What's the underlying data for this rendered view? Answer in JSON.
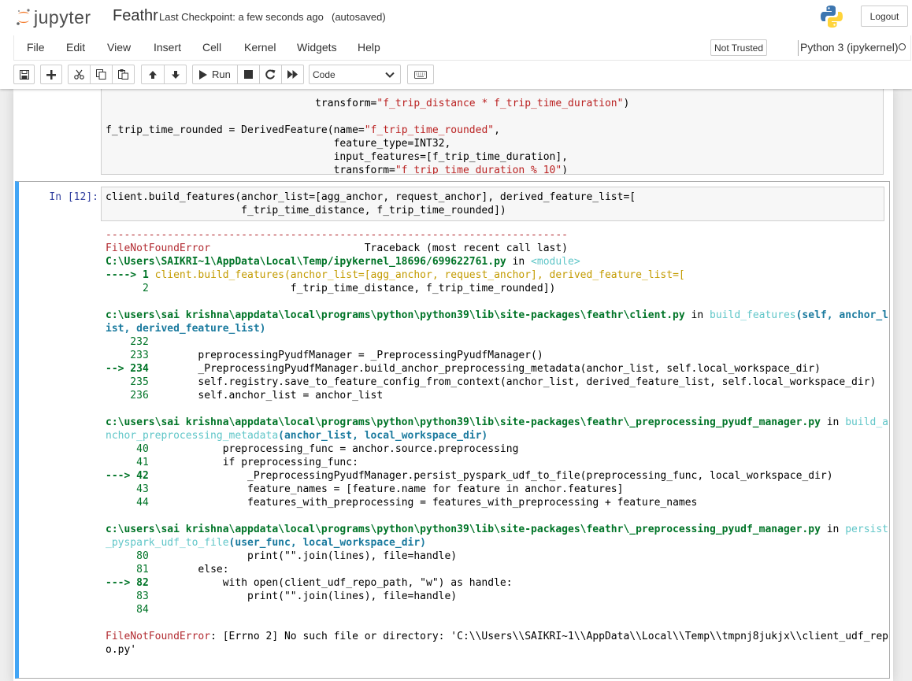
{
  "header": {
    "brand": "jupyter",
    "notebook_name": "Feathr",
    "checkpoint": "Last Checkpoint: a few seconds ago",
    "autosave": "(autosaved)",
    "logout_label": "Logout"
  },
  "menubar": {
    "items": [
      "File",
      "Edit",
      "View",
      "Insert",
      "Cell",
      "Kernel",
      "Widgets",
      "Help"
    ],
    "trust": "Not Trusted",
    "kernel": "Python 3 (ipykernel)"
  },
  "toolbar": {
    "run_label": "Run",
    "cell_type": "Code"
  },
  "cells": {
    "prev": {
      "line1_indent": "                                  ",
      "line1_kw": "transform=",
      "line1_str": "\"f_trip_distance * f_trip_time_duration\"",
      "line1_end": ")",
      "line2_a": "f_trip_time_rounded = DerivedFeature(name=",
      "line2_str": "\"f_trip_time_rounded\"",
      "line2_end": ",",
      "line3": "                                     feature_type=INT32,",
      "line4": "                                     input_features=[f_trip_time_duration],",
      "line5_a": "                                     transform=",
      "line5_str": "\"f_trip_time_duration % 10\"",
      "line5_end": ")"
    },
    "current": {
      "prompt": "In [12]:",
      "line1": "client.build_features(anchor_list=[agg_anchor, request_anchor], derived_feature_list=[",
      "line2": "                      f_trip_time_distance, f_trip_time_rounded])"
    }
  },
  "traceback": {
    "rule": "---------------------------------------------------------------------------",
    "err_name": "FileNotFoundError",
    "tb_header": "                         Traceback (most recent call last)",
    "f1_path": "C:\\Users\\SAIKRI~1\\AppData\\Local\\Temp/ipykernel_18696/699622761.py",
    "in_word": " in ",
    "f1_func": "<module>",
    "f1_arrow": "----> 1 ",
    "f1_l1": "client.build_features(anchor_list=[agg_anchor, request_anchor], derived_feature_list=[",
    "f1_n2": "      2 ",
    "f1_l2": "                      f_trip_time_distance, f_trip_time_rounded])",
    "f2_path": "c:\\users\\sai krishna\\appdata\\local\\programs\\python\\python39\\lib\\site-packages\\feathr\\client.py",
    "f2_func": "build_features",
    "f2_args1": "(self, anchor_l",
    "f2_args2": "ist, derived_feature_list)",
    "f2_lines": [
      {
        "no": "    232",
        "code": ""
      },
      {
        "no": "    233",
        "code": "        preprocessingPyudfManager = _PreprocessingPyudfManager()"
      },
      {
        "no": "--> 234",
        "code": "        _PreprocessingPyudfManager.build_anchor_preprocessing_metadata(anchor_list, self.local_workspace_dir)"
      },
      {
        "no": "    235",
        "code": "        self.registry.save_to_feature_config_from_context(anchor_list, derived_feature_list, self.local_workspace_dir)"
      },
      {
        "no": "    236",
        "code": "        self.anchor_list = anchor_list"
      }
    ],
    "f3_path": "c:\\users\\sai krishna\\appdata\\local\\programs\\python\\python39\\lib\\site-packages\\feathr\\_preprocessing_pyudf_manager.py",
    "f3_func1": "build_a",
    "f3_func2": "nchor_preprocessing_metadata",
    "f3_args": "(anchor_list, local_workspace_dir)",
    "f3_lines": [
      {
        "no": "     40",
        "code": "            preprocessing_func = anchor.source.preprocessing"
      },
      {
        "no": "     41",
        "code": "            if preprocessing_func:"
      },
      {
        "no": "---> 42",
        "code": "                _PreprocessingPyudfManager.persist_pyspark_udf_to_file(preprocessing_func, local_workspace_dir)"
      },
      {
        "no": "     43",
        "code": "                feature_names = [feature.name for feature in anchor.features]"
      },
      {
        "no": "     44",
        "code": "                features_with_preprocessing = features_with_preprocessing + feature_names"
      }
    ],
    "f4_path": "c:\\users\\sai krishna\\appdata\\local\\programs\\python\\python39\\lib\\site-packages\\feathr\\_preprocessing_pyudf_manager.py",
    "f4_func1": "persist",
    "f4_func2": "_pyspark_udf_to_file",
    "f4_args": "(user_func, local_workspace_dir)",
    "f4_lines": [
      {
        "no": "     80",
        "code": "                print(\"\".join(lines), file=handle)"
      },
      {
        "no": "     81",
        "code": "        else:"
      },
      {
        "no": "---> 82",
        "code": "            with open(client_udf_repo_path, \"w\") as handle:"
      },
      {
        "no": "     83",
        "code": "                print(\"\".join(lines), file=handle)"
      },
      {
        "no": "     84",
        "code": ""
      }
    ],
    "final_name": "FileNotFoundError",
    "final_msg1": ": [Errno 2] No such file or directory: 'C:\\\\Users\\\\SAIKRI~1\\\\AppData\\\\Local\\\\Temp\\\\tmpnj8jukjx\\\\client_udf_rep",
    "final_msg2": "o.py'"
  },
  "colors": {
    "selected_border": "#42a5f5",
    "prompt": "#303f9f",
    "error_red": "#b22b31",
    "path_green": "#007427",
    "func_cyan": "#60c6c8"
  }
}
